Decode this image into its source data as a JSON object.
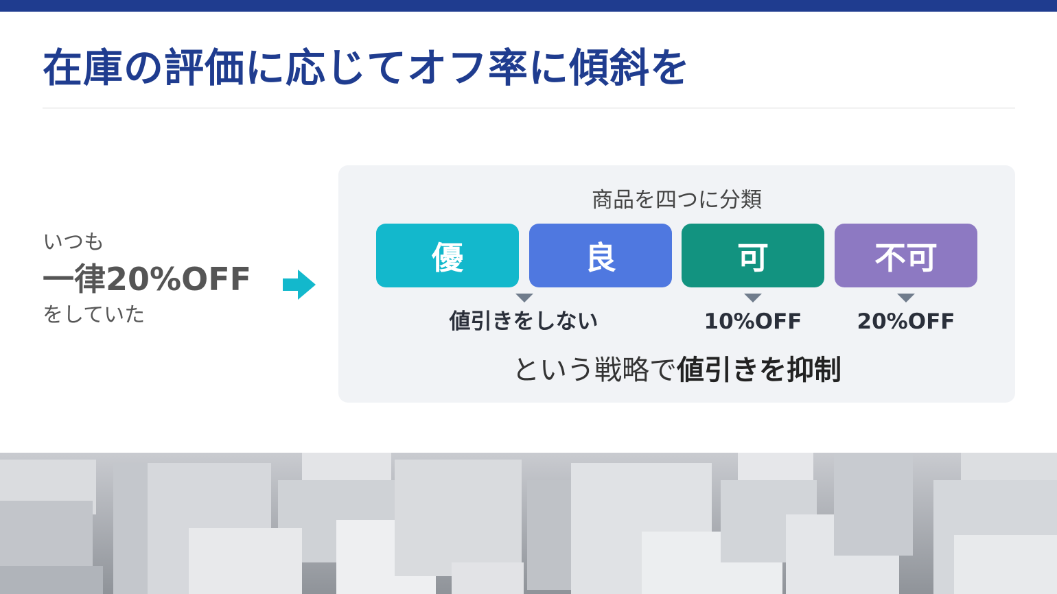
{
  "title": "在庫の評価に応じてオフ率に傾斜を",
  "left": {
    "line1": "いつも",
    "line2": "一律20%OFF",
    "line3": "をしていた"
  },
  "panel": {
    "heading": "商品を四つに分類",
    "categories": [
      {
        "label": "優",
        "color": "#13b8cc"
      },
      {
        "label": "良",
        "color": "#4f78e0"
      },
      {
        "label": "可",
        "color": "#129380"
      },
      {
        "label": "不可",
        "color": "#8d79c2"
      }
    ],
    "results": {
      "no_discount": "値引きをしない",
      "ten_percent": "10%OFF",
      "twenty_percent": "20%OFF"
    },
    "summary_normal": "という戦略で",
    "summary_bold": "値引きを抑制"
  },
  "colors": {
    "brand_navy": "#1f3c8f",
    "arrow": "#13b8cc"
  },
  "icons": {
    "arrow": "arrow-right-icon"
  }
}
